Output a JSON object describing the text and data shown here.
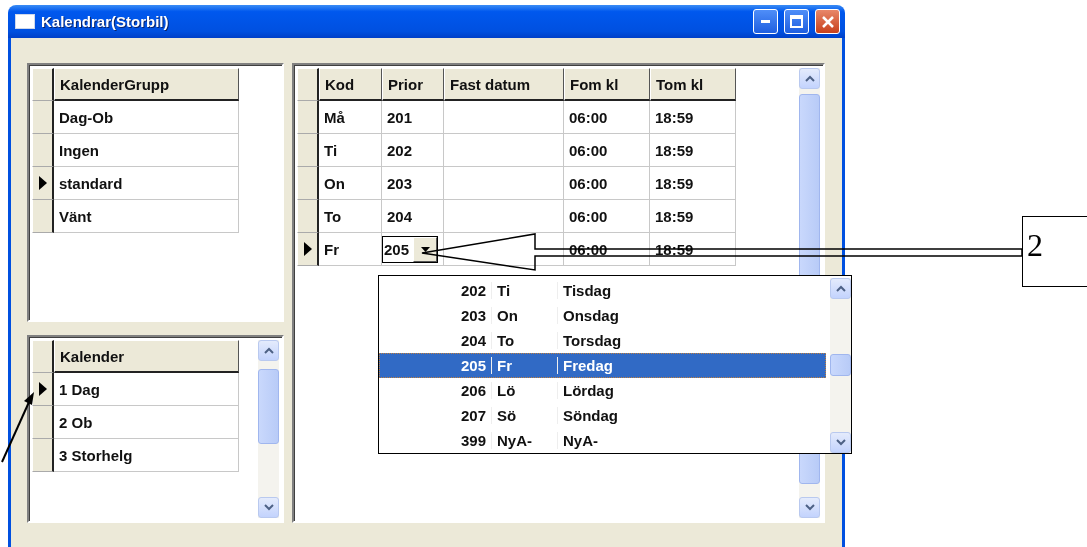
{
  "window": {
    "title": "Kalendrar(Storbil)"
  },
  "group_table": {
    "columns": [
      "KalenderGrupp"
    ],
    "rows": [
      {
        "cells": [
          "Dag-Ob"
        ],
        "selected": false
      },
      {
        "cells": [
          "Ingen"
        ],
        "selected": false
      },
      {
        "cells": [
          "standard"
        ],
        "selected": true
      },
      {
        "cells": [
          "Vänt"
        ],
        "selected": false
      }
    ]
  },
  "calendar_table": {
    "columns": [
      "Kalender"
    ],
    "rows": [
      {
        "cells": [
          "1 Dag"
        ],
        "selected": true
      },
      {
        "cells": [
          "2 Ob"
        ],
        "selected": false
      },
      {
        "cells": [
          "3 Storhelg"
        ],
        "selected": false
      }
    ]
  },
  "day_table": {
    "columns": [
      "Kod",
      "Prior",
      "Fast datum",
      "Fom kl",
      "Tom kl"
    ],
    "rows": [
      {
        "cells": [
          "Må",
          "201",
          "",
          "06:00",
          "18:59"
        ],
        "selected": false,
        "editing": false
      },
      {
        "cells": [
          "Ti",
          "202",
          "",
          "06:00",
          "18:59"
        ],
        "selected": false,
        "editing": false
      },
      {
        "cells": [
          "On",
          "203",
          "",
          "06:00",
          "18:59"
        ],
        "selected": false,
        "editing": false
      },
      {
        "cells": [
          "To",
          "204",
          "",
          "06:00",
          "18:59"
        ],
        "selected": false,
        "editing": false
      },
      {
        "cells": [
          "Fr",
          "205",
          "",
          "06:00",
          "18:59"
        ],
        "selected": true,
        "editing": true
      }
    ]
  },
  "dropdown": {
    "items": [
      {
        "prior": "202",
        "kod": "Ti",
        "name": "Tisdag",
        "selected": false
      },
      {
        "prior": "203",
        "kod": "On",
        "name": "Onsdag",
        "selected": false
      },
      {
        "prior": "204",
        "kod": "To",
        "name": "Torsdag",
        "selected": false
      },
      {
        "prior": "205",
        "kod": "Fr",
        "name": "Fredag",
        "selected": true
      },
      {
        "prior": "206",
        "kod": "Lö",
        "name": "Lördag",
        "selected": false
      },
      {
        "prior": "207",
        "kod": "Sö",
        "name": "Söndag",
        "selected": false
      },
      {
        "prior": "399",
        "kod": "NyA-",
        "name": "NyA-",
        "selected": false
      }
    ]
  },
  "callout": {
    "label": "2"
  }
}
